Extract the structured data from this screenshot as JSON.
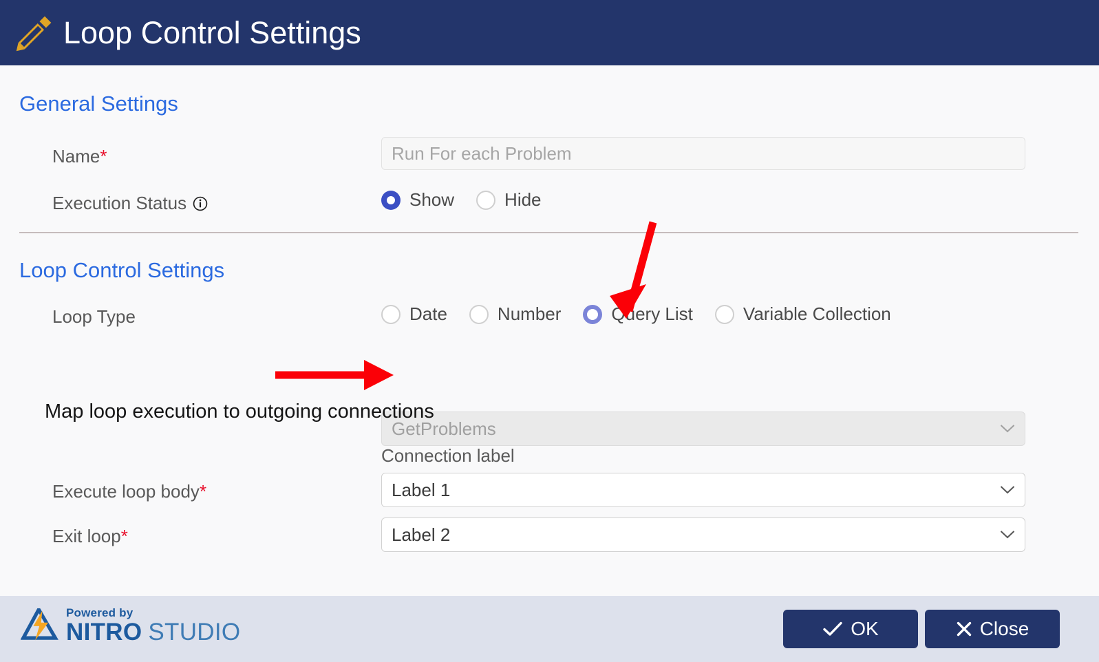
{
  "header": {
    "title": "Loop Control Settings",
    "icon": "pencil-icon",
    "background_color": "#23356b",
    "title_color": "#ffffff",
    "icon_color": "#e0a526"
  },
  "general_settings": {
    "section_title": "General Settings",
    "section_title_color": "#2b6ae0",
    "name": {
      "label": "Name",
      "required_marker": "*",
      "value": "",
      "placeholder": "Run For each Problem"
    },
    "execution_status": {
      "label": "Execution Status",
      "info_icon": "info-circle-icon",
      "selected": "Show",
      "options": [
        "Show",
        "Hide"
      ]
    }
  },
  "loop_control_settings": {
    "section_title": "Loop Control Settings",
    "section_title_color": "#2b6ae0",
    "loop_type": {
      "label": "Loop Type",
      "selected": "Query List",
      "options": [
        "Date",
        "Number",
        "Query List",
        "Variable Collection"
      ]
    },
    "query_list_select": {
      "value": "GetProblems",
      "disabled": true
    },
    "map_heading": "Map loop execution to outgoing connections",
    "connection_label_heading": "Connection label",
    "rows": [
      {
        "label": "Execute loop body",
        "required_marker": "*",
        "value": "Label 1"
      },
      {
        "label": "Exit loop",
        "required_marker": "*",
        "value": "Label 2"
      }
    ]
  },
  "footer": {
    "background_color": "#dde1ec",
    "logo": {
      "powered_by": "Powered by",
      "brand": "NITRO",
      "product": "STUDIO",
      "mark": "nitro-lightning-triangle-icon"
    },
    "ok_button": {
      "label": "OK",
      "icon": "check-icon"
    },
    "close_button": {
      "label": "Close",
      "icon": "close-x-icon"
    },
    "button_color": "#23356b"
  },
  "annotations": {
    "color": "#fb0007",
    "arrows": [
      {
        "name": "arrow-pointing-to-query-list-radio",
        "direction": "down-left"
      },
      {
        "name": "arrow-pointing-to-query-list-dropdown",
        "direction": "right"
      }
    ]
  }
}
